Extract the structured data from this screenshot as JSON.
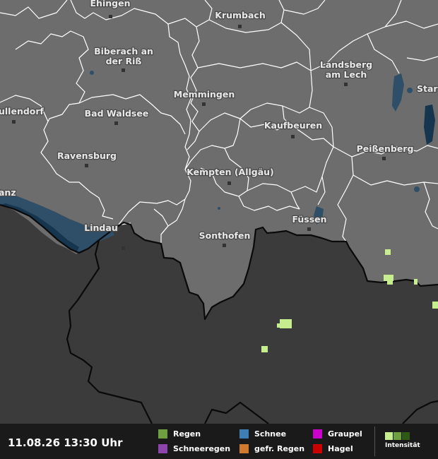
{
  "colors": {
    "land": "#6d6d6d",
    "outside": "#3b3b3b",
    "water": "#2f4f68",
    "lake": "#16364f",
    "admin_border": "#ffffff",
    "country_border": "#0a0a0a",
    "precip_light": "#c6ee8e",
    "precip_mid": "#6ea03f",
    "precip_dark": "#2f5a16",
    "legend_bg": "#1a1a1a"
  },
  "map": {
    "cities": [
      {
        "name": "Ehingen"
      },
      {
        "name": "Krumbach"
      },
      {
        "name": "Biberach an"
      },
      {
        "name": "der Riß"
      },
      {
        "name": "Landsberg"
      },
      {
        "name": "am Lech"
      },
      {
        "name": "Starnb"
      },
      {
        "name": "Memmingen"
      },
      {
        "name": "ullendorf"
      },
      {
        "name": "Bad Waldsee"
      },
      {
        "name": "Kaufbeuren"
      },
      {
        "name": "Ravensburg"
      },
      {
        "name": "Peißenberg"
      },
      {
        "name": "Kempten (Allgäu)"
      },
      {
        "name": "anz"
      },
      {
        "name": "Lindau"
      },
      {
        "name": "Füssen"
      },
      {
        "name": "Sonthofen"
      }
    ]
  },
  "footer": {
    "timestamp": "11.08.26 13:30 Uhr",
    "legend": [
      {
        "label": "Regen",
        "color": "#6ea03f",
        "icon": "swatch-rain"
      },
      {
        "label": "Schneeregen",
        "color": "#8e44ad",
        "icon": "swatch-sleet"
      },
      {
        "label": "Schnee",
        "color": "#3d7fb5",
        "icon": "swatch-snow"
      },
      {
        "label": "gefr. Regen",
        "color": "#d07a2e",
        "icon": "swatch-freezing-rain"
      },
      {
        "label": "Graupel",
        "color": "#cc00cc",
        "icon": "swatch-graupel"
      },
      {
        "label": "Hagel",
        "color": "#cc0000",
        "icon": "swatch-hail"
      }
    ],
    "intensity_label": "Intensität",
    "intensity_colors": [
      "#c6ee8e",
      "#6ea03f",
      "#2f5a16"
    ]
  }
}
